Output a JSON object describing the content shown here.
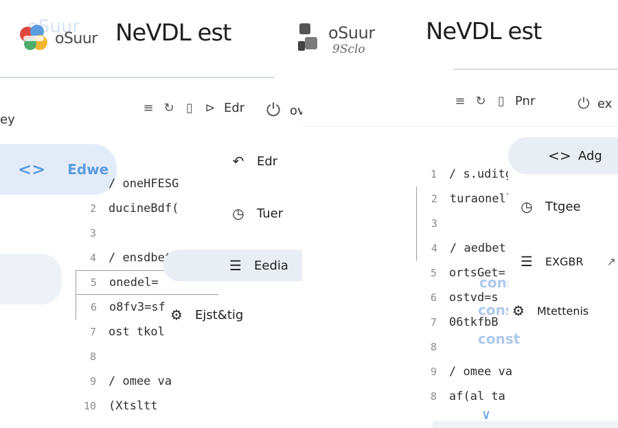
{
  "brand": {
    "name": "oSuur",
    "subtitle": "9Sclo"
  },
  "documents": [
    {
      "title": "NeVDL est"
    },
    {
      "title": "NeVDL est"
    }
  ],
  "left_panel": {
    "header_label": "ey",
    "toolbar": {
      "item_label": "Edr"
    },
    "overflow_label": "overiew",
    "rail": [
      {
        "label": "Edwe",
        "icon": "code-icon",
        "active": true
      }
    ],
    "menu": [
      {
        "label": "Edr",
        "icon": "undo-icon"
      },
      {
        "label": "Tuer",
        "icon": "clock-icon"
      },
      {
        "label": "Eedia",
        "icon": "list-icon",
        "selected": true
      },
      {
        "label": "Ejst&tig",
        "icon": "gear-icon"
      }
    ],
    "code": [
      {
        "n": "",
        "text": "/ oneHFESG"
      },
      {
        "n": "2",
        "text": "ducineBdf("
      },
      {
        "n": "3",
        "text": ""
      },
      {
        "n": "4",
        "text": "/ ensdbet"
      },
      {
        "n": "5",
        "text": "onedel="
      },
      {
        "n": "6",
        "text": "o8fv3=sf"
      },
      {
        "n": "7",
        "text": "ost tkol"
      },
      {
        "n": "8",
        "text": ""
      },
      {
        "n": "9",
        "text": "/ omee va"
      },
      {
        "n": "10",
        "text": "(Xtsltt"
      }
    ]
  },
  "right_panel": {
    "toolbar": {
      "item_label": "Pnr"
    },
    "overflow_label": "ex",
    "menu": [
      {
        "label": "Adg",
        "icon": "code-icon"
      },
      {
        "label": "Ttgee",
        "icon": "clock-icon"
      },
      {
        "label": "EXGBR",
        "icon": "list-icon"
      },
      {
        "label": "Mtettenis",
        "icon": "gear-icon"
      }
    ],
    "ghost_words": [
      "const",
      "const",
      "const"
    ],
    "code": [
      {
        "n": "1",
        "text": "/ s.uditge"
      },
      {
        "n": "2",
        "text": "turaonell("
      },
      {
        "n": "3",
        "text": ""
      },
      {
        "n": "4",
        "text": "/ aedbet"
      },
      {
        "n": "5",
        "text": "ortsGet="
      },
      {
        "n": "6",
        "text": "ostvd=s"
      },
      {
        "n": "7",
        "text": "06tkfbB"
      },
      {
        "n": "8",
        "text": ""
      },
      {
        "n": "9",
        "text": "/ omee va"
      },
      {
        "n": "8",
        "text": "af(al ta"
      }
    ]
  },
  "colors": {
    "accent": "#5b9be0",
    "rail_active_bg": "#e2ecf8",
    "menu_selected_bg": "#e9eef5"
  }
}
